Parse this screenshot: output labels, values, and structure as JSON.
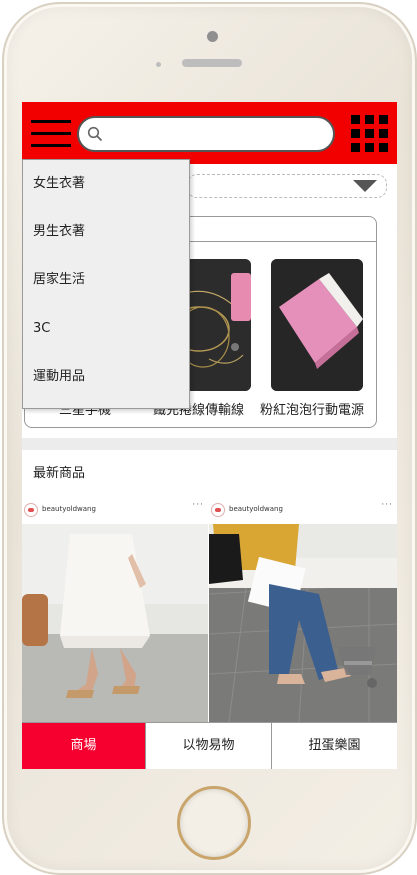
{
  "search": {
    "placeholder": ""
  },
  "drawer": {
    "items": [
      {
        "label": "女生衣著"
      },
      {
        "label": "男生衣著"
      },
      {
        "label": "居家生活"
      },
      {
        "label": "3C"
      },
      {
        "label": "運動用品"
      }
    ]
  },
  "products": [
    {
      "label": "三星手機"
    },
    {
      "label": "鐵充捲線傳輸線"
    },
    {
      "label": "粉紅泡泡行動電源"
    }
  ],
  "latest": {
    "title": "最新商品"
  },
  "posts": [
    {
      "username": "beautyoldwang",
      "more": "···"
    },
    {
      "username": "beautyoldwang",
      "more": "···"
    }
  ],
  "tabs": [
    {
      "label": "商場"
    },
    {
      "label": "以物易物"
    },
    {
      "label": "扭蛋樂園"
    }
  ],
  "colors": {
    "brand_red": "#f20000",
    "active_tab": "#f5002f"
  }
}
